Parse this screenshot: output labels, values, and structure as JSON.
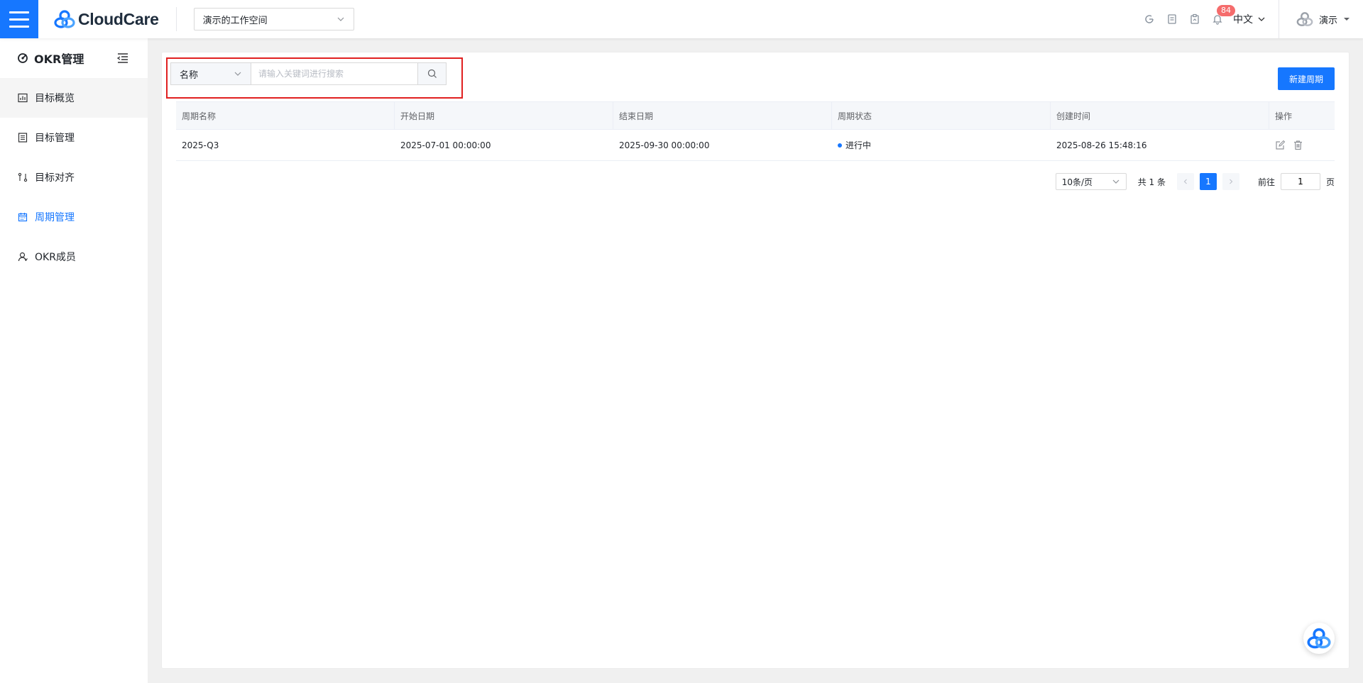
{
  "header": {
    "logo_text": "CloudCare",
    "workspace": "演示的工作空间",
    "notification_count": "84",
    "language": "中文",
    "user_name": "演示"
  },
  "sidebar": {
    "title": "OKR管理",
    "items": [
      {
        "label": "目标概览",
        "icon": "chart-icon"
      },
      {
        "label": "目标管理",
        "icon": "list-icon"
      },
      {
        "label": "目标对齐",
        "icon": "align-icon"
      },
      {
        "label": "周期管理",
        "icon": "calendar-icon",
        "active": true
      },
      {
        "label": "OKR成员",
        "icon": "user-icon"
      }
    ]
  },
  "search": {
    "field": "名称",
    "placeholder": "请输入关键词进行搜索"
  },
  "toolbar": {
    "new_label": "新建周期"
  },
  "table": {
    "columns": [
      "周期名称",
      "开始日期",
      "结束日期",
      "周期状态",
      "创建时间",
      "操作"
    ],
    "rows": [
      {
        "name": "2025-Q3",
        "start": "2025-07-01 00:00:00",
        "end": "2025-09-30 00:00:00",
        "status": "进行中",
        "created": "2025-08-26 15:48:16"
      }
    ]
  },
  "pagination": {
    "page_size": "10条/页",
    "total": "共 1 条",
    "current_page": "1",
    "goto_label": "前往",
    "goto_value": "1",
    "goto_suffix": "页"
  },
  "colors": {
    "primary": "#1677ff",
    "highlight_border": "#e02020",
    "badge": "#f56c6c"
  }
}
